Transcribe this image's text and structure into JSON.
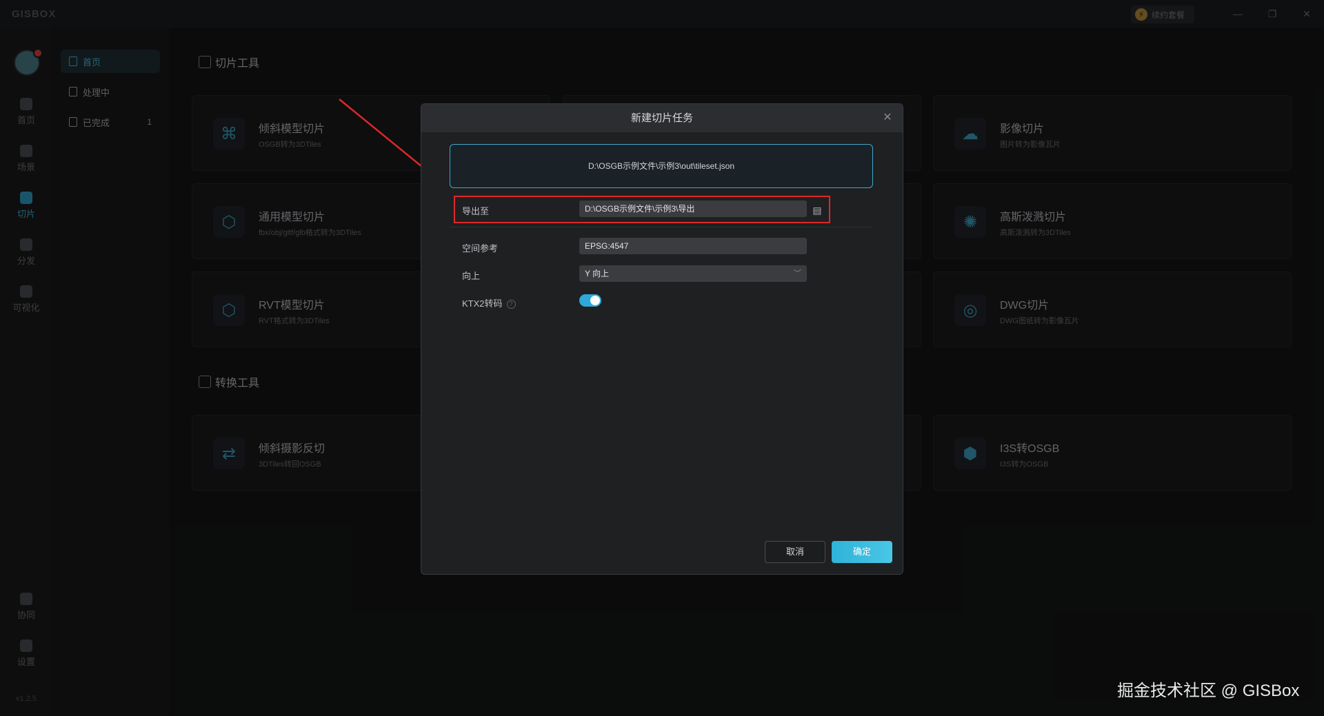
{
  "app": {
    "logo": "GISBOX",
    "renew": "续约套餐",
    "version": "v1.2.5"
  },
  "window": {
    "minimize": "—",
    "restore": "❐",
    "close": "✕"
  },
  "rail": [
    {
      "label": "首页"
    },
    {
      "label": "场景"
    },
    {
      "label": "切片"
    },
    {
      "label": "分发"
    },
    {
      "label": "可视化"
    },
    {
      "label": "协同"
    },
    {
      "label": "设置"
    }
  ],
  "subnav": [
    {
      "label": "首页"
    },
    {
      "label": "处理中"
    },
    {
      "label": "已完成",
      "count": "1"
    }
  ],
  "sections": {
    "slice": "切片工具",
    "convert": "转换工具"
  },
  "cards": [
    {
      "title": "倾斜模型切片",
      "sub": "OSGB转为3DTiles",
      "icon": "drone-icon",
      "glyph": "⌘"
    },
    {
      "title": "通用模型切片",
      "sub": "fbx/obj/gltf/glb格式转为3DTiles",
      "icon": "cube-icon",
      "glyph": "⬡"
    },
    {
      "title": "RVT模型切片",
      "sub": "RVT格式转为3DTiles",
      "icon": "cube-icon",
      "glyph": "⬡"
    },
    {
      "title": "影像切片",
      "sub": "图片转为影像瓦片",
      "icon": "cloud-icon",
      "glyph": "☁"
    },
    {
      "title": "高斯泼溅切片",
      "sub": "高斯泼溅转为3DTiles",
      "icon": "splat-icon",
      "glyph": "✺"
    },
    {
      "title": "DWG切片",
      "sub": "DWG图纸转为影像瓦片",
      "icon": "disc-icon",
      "glyph": "◎"
    },
    {
      "title": "倾斜摄影反切",
      "sub": "3DTiles转回OSGB",
      "icon": "convert-icon",
      "glyph": "⇄"
    },
    {
      "title": "I3S转OSGB",
      "sub": "I3S转为OSGB",
      "icon": "box-icon",
      "glyph": "⬢"
    }
  ],
  "modal": {
    "title": "新建切片任务",
    "source_path": "D:\\OSGB示例文件\\示例3\\out\\tileset.json",
    "export_label": "导出至",
    "export_value": "D:\\OSGB示例文件\\示例3\\导出",
    "srs_label": "空间参考",
    "srs_value": "EPSG:4547",
    "up_label": "向上",
    "up_value": "Y 向上",
    "ktx2_label": "KTX2转码",
    "ktx2_enabled": true,
    "cancel": "取消",
    "ok": "确定"
  },
  "watermark": "掘金技术社区 @ GISBox"
}
